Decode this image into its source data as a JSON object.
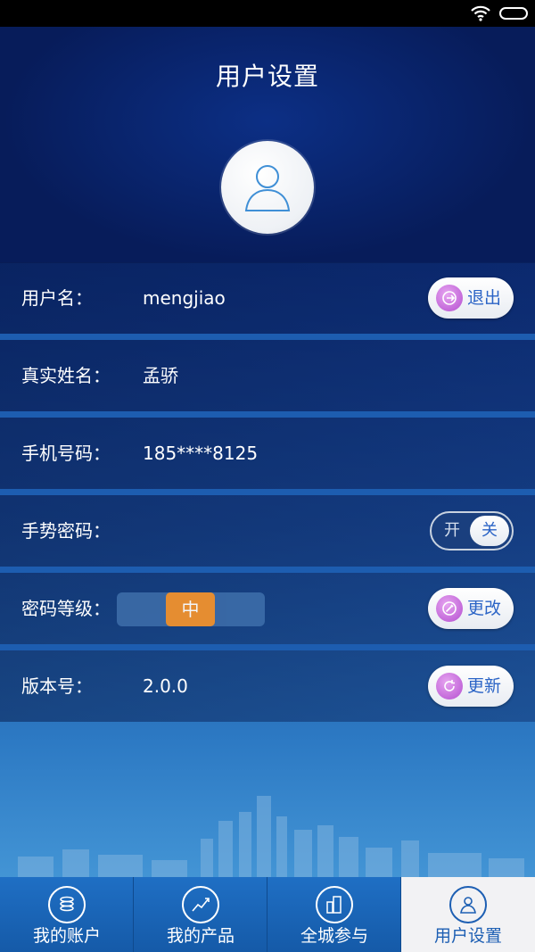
{
  "status_bar": {
    "wifi_icon": "wifi-icon",
    "battery_icon": "battery-icon"
  },
  "header": {
    "title": "用户设置",
    "avatar_icon": "user-avatar-icon"
  },
  "rows": {
    "username": {
      "label": "用户名：",
      "value": "mengjiao",
      "button": {
        "label": "退出",
        "icon": "logout-icon"
      }
    },
    "real_name": {
      "label": "真实姓名：",
      "value": "孟骄"
    },
    "phone": {
      "label": "手机号码：",
      "value": "185****8125"
    },
    "gesture_password": {
      "label": "手势密码：",
      "toggle": {
        "on_label": "开",
        "off_label": "关",
        "state": "off"
      }
    },
    "password_level": {
      "label": "密码等级：",
      "level": "中",
      "button": {
        "label": "更改",
        "icon": "edit-icon"
      }
    },
    "version": {
      "label": "版本号：",
      "value": "2.0.0",
      "button": {
        "label": "更新",
        "icon": "refresh-icon"
      }
    }
  },
  "tabbar": {
    "tabs": [
      {
        "label": "我的账户",
        "icon": "coins-icon",
        "active": false
      },
      {
        "label": "我的产品",
        "icon": "chart-icon",
        "active": false
      },
      {
        "label": "全城参与",
        "icon": "buildings-icon",
        "active": false
      },
      {
        "label": "用户设置",
        "icon": "user-settings-icon",
        "active": true
      }
    ]
  },
  "colors": {
    "accent": "#2b64c6",
    "level_mid": "#f1922d",
    "button_icon": "#b44fd0"
  }
}
